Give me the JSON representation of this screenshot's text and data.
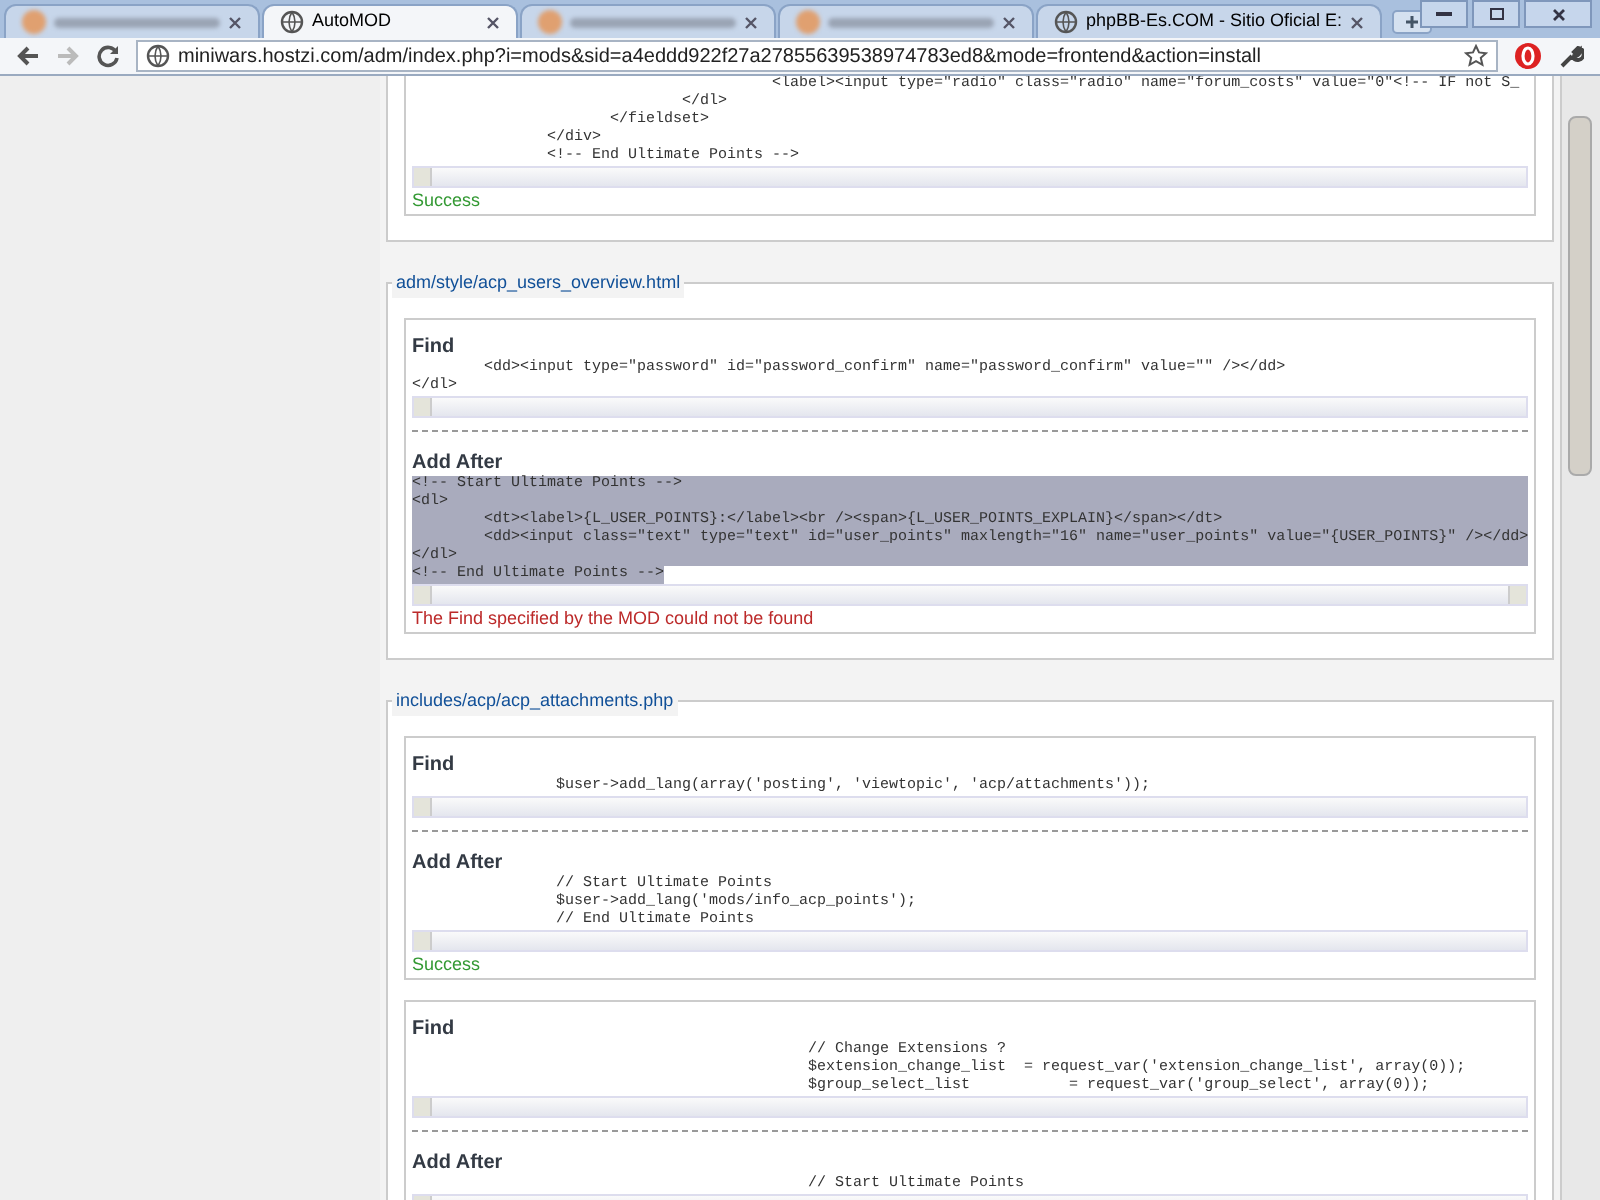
{
  "browser": {
    "tabs": [
      {
        "blurred": true,
        "selected": false
      },
      {
        "title": "AutoMOD",
        "blurred": false,
        "selected": true
      },
      {
        "blurred": true,
        "selected": false
      },
      {
        "blurred": true,
        "selected": false
      },
      {
        "title": "phpBB-Es.COM - Sitio Oficial E:",
        "blurred": false,
        "selected": false
      }
    ],
    "url": "miniwars.hostzi.com/adm/index.php?i=mods&sid=a4eddd922f27a27855639538974783ed8&mode=frontend&action=install"
  },
  "sections": [
    {
      "groups": [
        {
          "steps": [
            {
              "lines": [
                "                                        <label><input type=\"radio\" class=\"radio\" name=\"forum_costs\" value=\"0\"<!-- IF not S_",
                "                              </dl>",
                "                      </fieldset>",
                "               </div>",
                "               <!-- End Ultimate Points -->"
              ],
              "highlighted": false
            }
          ],
          "status": {
            "text": "Success",
            "kind": "success"
          }
        }
      ]
    },
    {
      "file": "adm/style/acp_users_overview.html",
      "groups": [
        {
          "steps": [
            {
              "heading": "Find",
              "lines": [
                "        <dd><input type=\"password\" id=\"password_confirm\" name=\"password_confirm\" value=\"\" /></dd>",
                "</dl>"
              ],
              "highlighted": false
            },
            {
              "heading": "Add After",
              "lines": [
                "<!-- Start Ultimate Points -->",
                "<dl>",
                "        <dt><label>{L_USER_POINTS}:</label><br /><span>{L_USER_POINTS_EXPLAIN}</span></dt>",
                "        <dd><input class=\"text\" type=\"text\" id=\"user_points\" maxlength=\"16\" name=\"user_points\" value=\"{USER_POINTS}\" /></dd>",
                "</dl>",
                "<!-- End Ultimate Points -->"
              ],
              "highlighted": true
            }
          ],
          "status": {
            "text": "The Find specified by the MOD could not be found",
            "kind": "error"
          }
        }
      ]
    },
    {
      "file": "includes/acp/acp_attachments.php",
      "groups": [
        {
          "steps": [
            {
              "heading": "Find",
              "lines": [
                "                $user->add_lang(array('posting', 'viewtopic', 'acp/attachments'));"
              ],
              "highlighted": false
            },
            {
              "heading": "Add After",
              "lines": [
                "                // Start Ultimate Points",
                "                $user->add_lang('mods/info_acp_points');",
                "                // End Ultimate Points"
              ],
              "highlighted": false
            }
          ],
          "status": {
            "text": "Success",
            "kind": "success"
          }
        },
        {
          "steps": [
            {
              "heading": "Find",
              "lines": [
                "                                            // Change Extensions ?",
                "                                            $extension_change_list  = request_var('extension_change_list', array(0));",
                "                                            $group_select_list           = request_var('group_select', array(0));"
              ],
              "highlighted": false
            },
            {
              "heading": "Add After",
              "lines": [
                "                                            // Start Ultimate Points"
              ],
              "highlighted": false
            }
          ]
        }
      ]
    }
  ]
}
